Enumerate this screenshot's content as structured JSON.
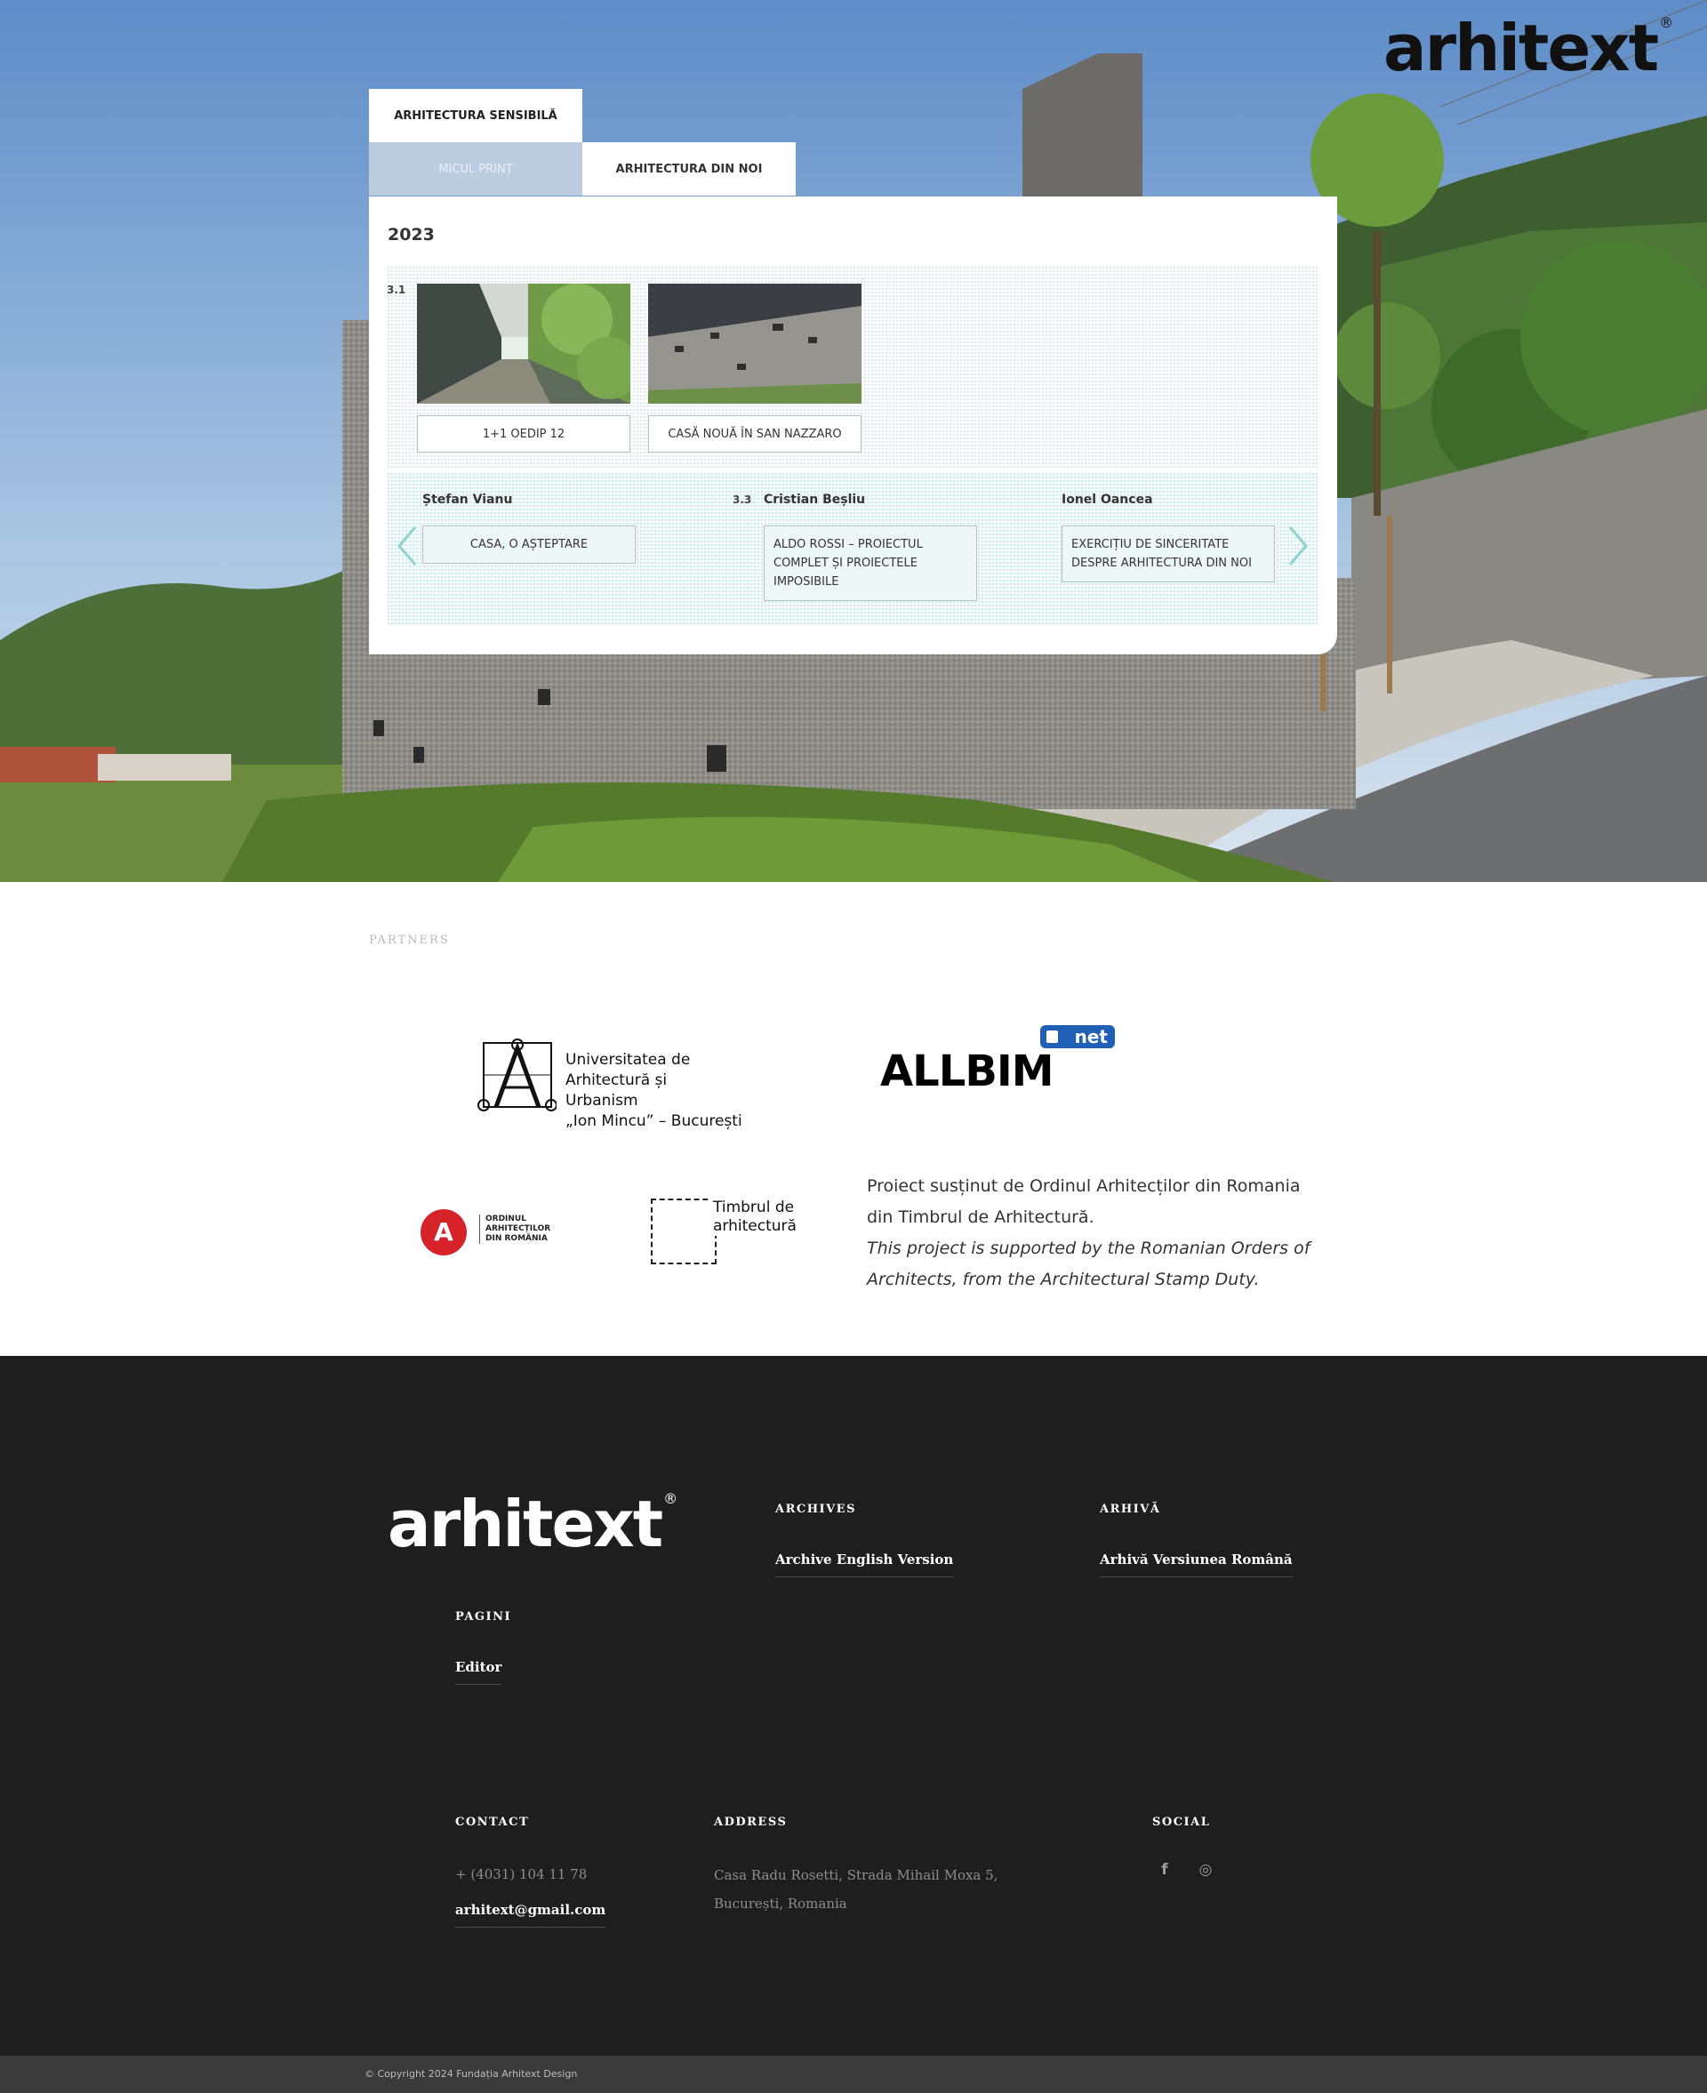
{
  "brand": {
    "logo": "arhitext",
    "registered": "®"
  },
  "tabs": [
    {
      "label": "ARHITECTURA SENSIBILĂ",
      "active": true
    },
    {
      "label": "MICUL PRINȚ",
      "active": false
    },
    {
      "label": "ARHITECTURA DIN NOI",
      "active": false
    }
  ],
  "panel": {
    "year": "2023",
    "issue_number": "3.1",
    "articles": [
      {
        "label": "1+1 OEDIP 12",
        "image": "corridor-with-plants"
      },
      {
        "label": "CASĂ NOUĂ ÎN SAN NAZZARO",
        "image": "stone-wall-building"
      }
    ],
    "carousel": {
      "items": [
        {
          "number": "",
          "author": "Ștefan Vianu",
          "title": "CASA, O AȘTEPTARE"
        },
        {
          "number": "3.3",
          "author": "Cristian Beșliu",
          "title": "ALDO ROSSI – PROIECTUL COMPLET ȘI PROIECTELE IMPOSIBILE"
        },
        {
          "number": "",
          "author": "Ionel Oancea",
          "title": "EXERCIȚIU DE SINCERITATE DESPRE ARHITECTURA DIN NOI"
        }
      ],
      "prev_icon": "chevron-left-icon",
      "next_icon": "chevron-right-icon"
    }
  },
  "partners": {
    "label": "PARTNERS",
    "uaum_lines": [
      "Universitatea de",
      "Arhitectură și Urbanism",
      "„Ion Mincu” – București"
    ],
    "allbim": {
      "word": "ALLBIM",
      "badge": "net"
    },
    "oar_lines": [
      "ORDINUL",
      "ARHITECȚILOR",
      "DIN ROMÂNIA"
    ],
    "timbru_lines": [
      "Timbrul de",
      "arhitectură"
    ],
    "support_ro": "Proiect susținut de Ordinul Arhitecților din Romania din Timbrul de Arhitectură.",
    "support_en": "This project is supported by the Romanian Orders of Architects, from the Architectural Stamp Duty."
  },
  "footer": {
    "archives": {
      "heading": "ARCHIVES",
      "link": "Archive English Version"
    },
    "arhiva": {
      "heading": "ARHIVĂ",
      "link": "Arhivă Versiunea Română"
    },
    "pagini": {
      "heading": "PAGINI",
      "link": "Editor"
    },
    "contact": {
      "heading": "CONTACT",
      "phone": "+ (4031) 104 11 78",
      "email": "arhitext@gmail.com"
    },
    "address": {
      "heading": "ADDRESS",
      "line1": "Casa Radu Rosetti, Strada Mihail Moxa 5,",
      "line2": "București, Romania"
    },
    "social": {
      "heading": "SOCIAL",
      "icons": [
        "facebook-icon",
        "instagram-icon"
      ],
      "facebook_glyph": "f",
      "instagram_glyph": "◎"
    },
    "copyright": "© Copyright 2024 Fundația Arhitext Design"
  },
  "colors": {
    "tab_inactive": "#bccde0",
    "footer_bg": "#1e1e1f",
    "copy_bar": "#3a3a3b",
    "oar_red": "#d6232a",
    "allbim_blue": "#1f5fb4"
  }
}
